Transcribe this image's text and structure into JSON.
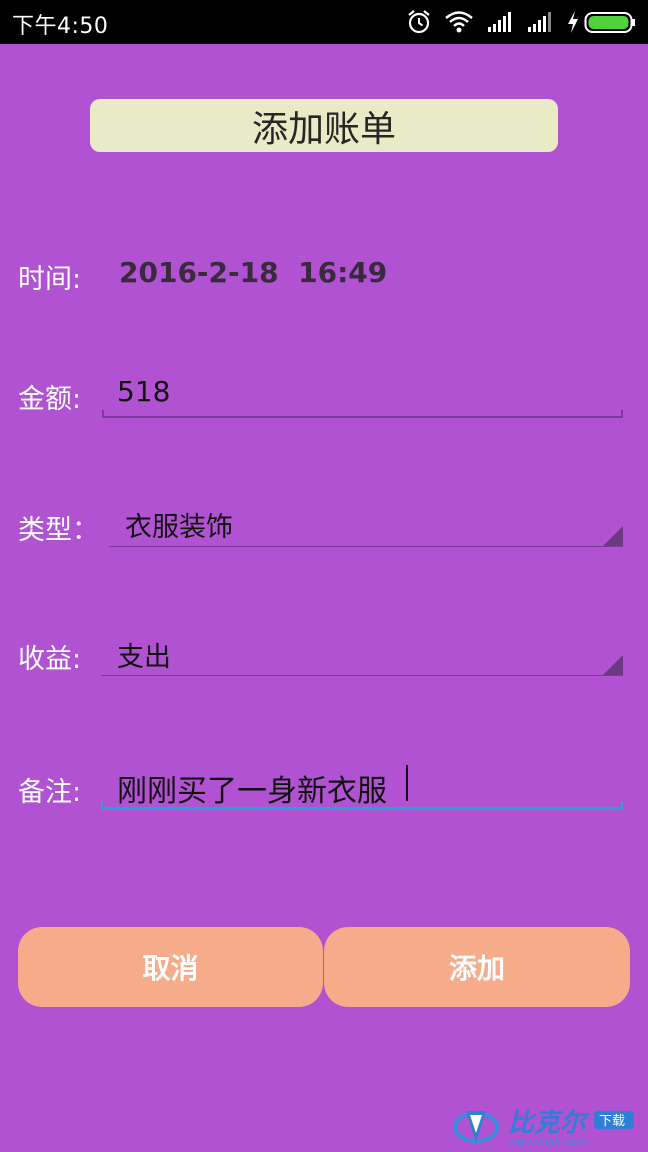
{
  "status_bar": {
    "time": "下午4:50",
    "icons": [
      "alarm-icon",
      "wifi-icon",
      "signal-icon",
      "signal-icon",
      "charging-icon",
      "battery-icon"
    ]
  },
  "title": "添加账单",
  "form": {
    "time_label": "时间:",
    "time_value": "2016-2-18  16:49",
    "amount_label": "金额:",
    "amount_value": "518",
    "type_label": "类型：",
    "type_value": "衣服装饰",
    "income_label": "收益:",
    "income_value": "支出",
    "note_label": "备注:",
    "note_value": "刚刚买了一身新衣服"
  },
  "buttons": {
    "cancel": "取消",
    "add": "添加"
  },
  "watermark": {
    "text": "比克尔",
    "badge": "下载",
    "url": "www.bkill.com"
  },
  "colors": {
    "background": "#b052d2",
    "title_box": "#e9eac6",
    "button": "#f6ab8a",
    "focus_underline": "#2aa0d8"
  }
}
